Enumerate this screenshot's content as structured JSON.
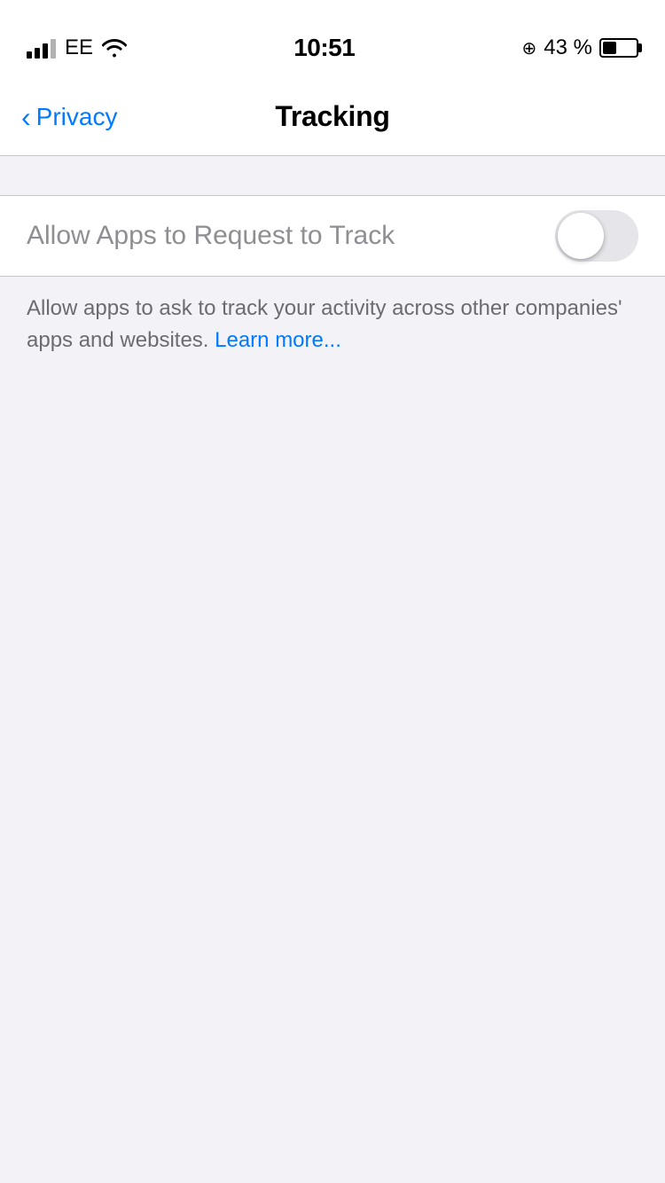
{
  "status_bar": {
    "carrier": "EE",
    "time": "10:51",
    "battery_percent": "43 %"
  },
  "nav": {
    "back_label": "Privacy",
    "title": "Tracking"
  },
  "settings": {
    "toggle_label": "Allow Apps to Request to Track",
    "toggle_state": false,
    "description": "Allow apps to ask to track your activity across other companies' apps and websites.",
    "learn_more_label": "Learn more..."
  }
}
